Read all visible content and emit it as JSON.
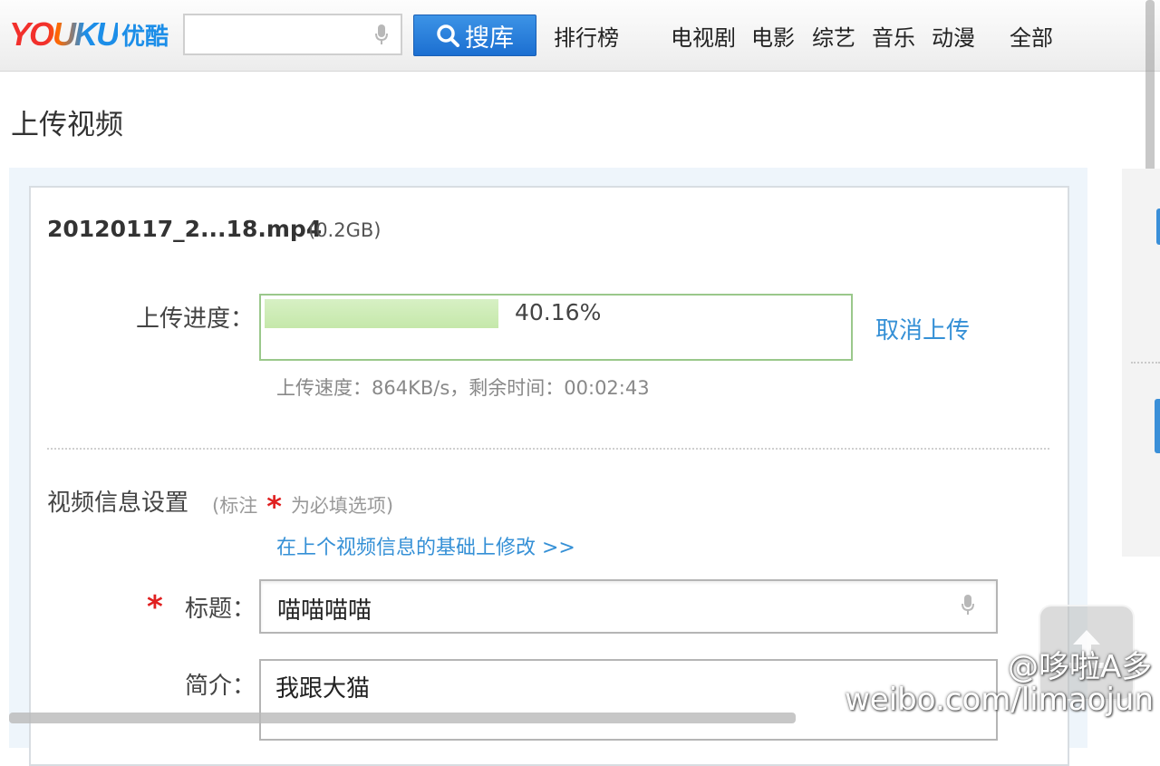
{
  "header": {
    "logo_text": "YOUKU",
    "logo_cn": "优酷",
    "search": {
      "value": "",
      "placeholder": ""
    },
    "search_button": "搜库",
    "nav": [
      "排行榜",
      "电视剧",
      "电影",
      "综艺",
      "音乐",
      "动漫",
      "全部"
    ]
  },
  "page": {
    "title": "上传视频"
  },
  "upload": {
    "filename": "20120117_2...18.mp4",
    "filesize": "(0.2GB)",
    "progress_label": "上传进度：",
    "progress_percent_text": "40.16%",
    "progress_value": 0.4016,
    "cancel_label": "取消上传",
    "speed_text": "上传速度：864KB/s，剩余时间：00:02:43"
  },
  "info": {
    "section_title": "视频信息设置",
    "note_prefix": "(标注",
    "note_star": "*",
    "note_suffix": "为必填选项)",
    "reuse_link": "在上个视频信息的基础上修改 >>",
    "title_star": "*",
    "title_label": "标题：",
    "title_value": "喵喵喵喵",
    "desc_label": "简介：",
    "desc_value": "我跟大猫"
  },
  "watermark": {
    "line1": "@哆啦A多",
    "line2": "weibo.com/limaojun"
  },
  "colors": {
    "accent_blue": "#3590d6",
    "progress_green": "#c5e8aa",
    "required_red": "#e02020"
  }
}
